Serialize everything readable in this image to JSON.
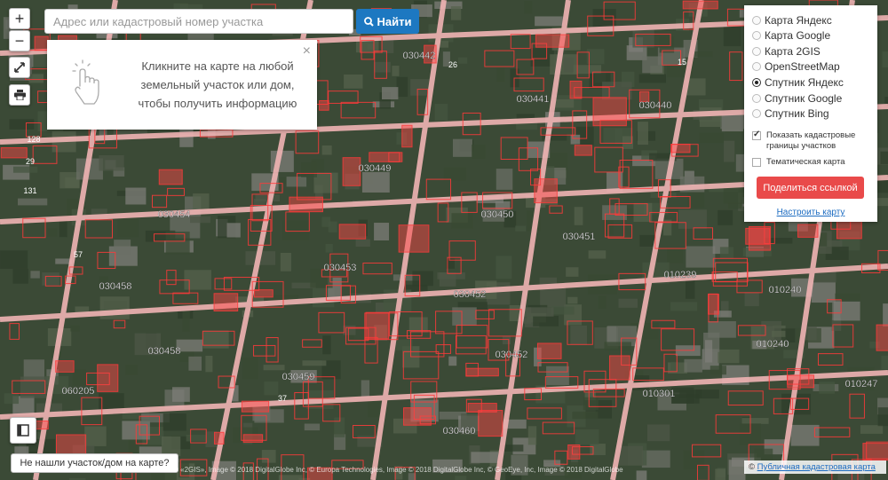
{
  "search": {
    "placeholder": "Адрес или кадастровый номер участка",
    "button_label": "Найти"
  },
  "controls": {
    "zoom_in": "+",
    "zoom_out": "−"
  },
  "popup": {
    "text": "Кликните на карте на любой земельный участок или дом, чтобы получить информацию",
    "close": "×"
  },
  "layers": {
    "options": [
      "Карта Яндекс",
      "Карта Google",
      "Карта 2GIS",
      "OpenStreetMap",
      "Спутник Яндекс",
      "Спутник Google",
      "Спутник Bing"
    ],
    "selected_index": 4,
    "show_borders_label": "Показать кадастровые границы участков",
    "show_borders_checked": true,
    "thematic_label": "Тематическая карта",
    "thematic_checked": false,
    "share_label": "Поделиться ссылкой",
    "settings_label": "Настроить карту"
  },
  "map": {
    "quarter_labels": [
      "030442",
      "030441",
      "030440",
      "030449",
      "030454",
      "030450",
      "030453",
      "030451",
      "030452",
      "030458",
      "030458",
      "030452",
      "030459",
      "030460",
      "060205",
      "010239",
      "010240",
      "010240",
      "010301",
      "010247"
    ],
    "parcel_numbers": [
      "128",
      "29",
      "131",
      "57",
      "26",
      "15",
      "37"
    ]
  },
  "footer": {
    "not_found_label": "Не нашли участок/дом на карте?",
    "attribution": "© «2GIS», Image © 2018 DigitalGlobe Inc, © Europa Technologies, Image © 2018 DigitalGlobe Inc, © GeoEye, Inc, Image © 2018 DigitalGlobe",
    "copyright_symbol": "©",
    "copyright_link": "Публичная кадастровая карта"
  },
  "colors": {
    "accent": "#1d78c1",
    "share": "#e94a4a",
    "parcel_border": "#ff3a3a"
  }
}
